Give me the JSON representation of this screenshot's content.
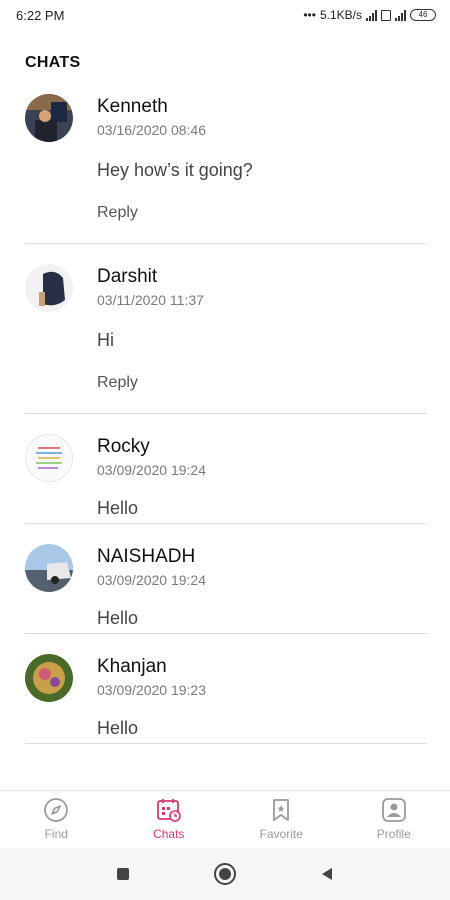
{
  "status": {
    "time": "6:22 PM",
    "speed": "5.1KB/s",
    "battery": "46"
  },
  "header": {
    "title": "CHATS"
  },
  "chats": [
    {
      "name": "Kenneth",
      "date": "03/16/2020 08:46",
      "message": "Hey how’s it going?",
      "reply": "Reply",
      "avatar": "photo-avatar"
    },
    {
      "name": "Darshit",
      "date": "03/11/2020 11:37",
      "message": "Hi",
      "reply": "Reply",
      "avatar": "photo-avatar"
    },
    {
      "name": "Rocky",
      "date": "03/09/2020 19:24",
      "message": "Hello",
      "avatar": "photo-avatar"
    },
    {
      "name": "NAISHADH",
      "date": "03/09/2020 19:24",
      "message": "Hello",
      "avatar": "photo-avatar"
    },
    {
      "name": "Khanjan",
      "date": "03/09/2020 19:23",
      "message": "Hello",
      "avatar": "photo-avatar"
    }
  ],
  "nav": [
    {
      "label": "Find",
      "icon": "compass-icon"
    },
    {
      "label": "Chats",
      "icon": "calendar-clock-icon",
      "active": true
    },
    {
      "label": "Favorite",
      "icon": "bookmark-icon"
    },
    {
      "label": "Profile",
      "icon": "profile-icon"
    }
  ],
  "colors": {
    "accent": "#d8386f",
    "inactive": "#9a9a9a",
    "divider": "#dcdcdc"
  }
}
